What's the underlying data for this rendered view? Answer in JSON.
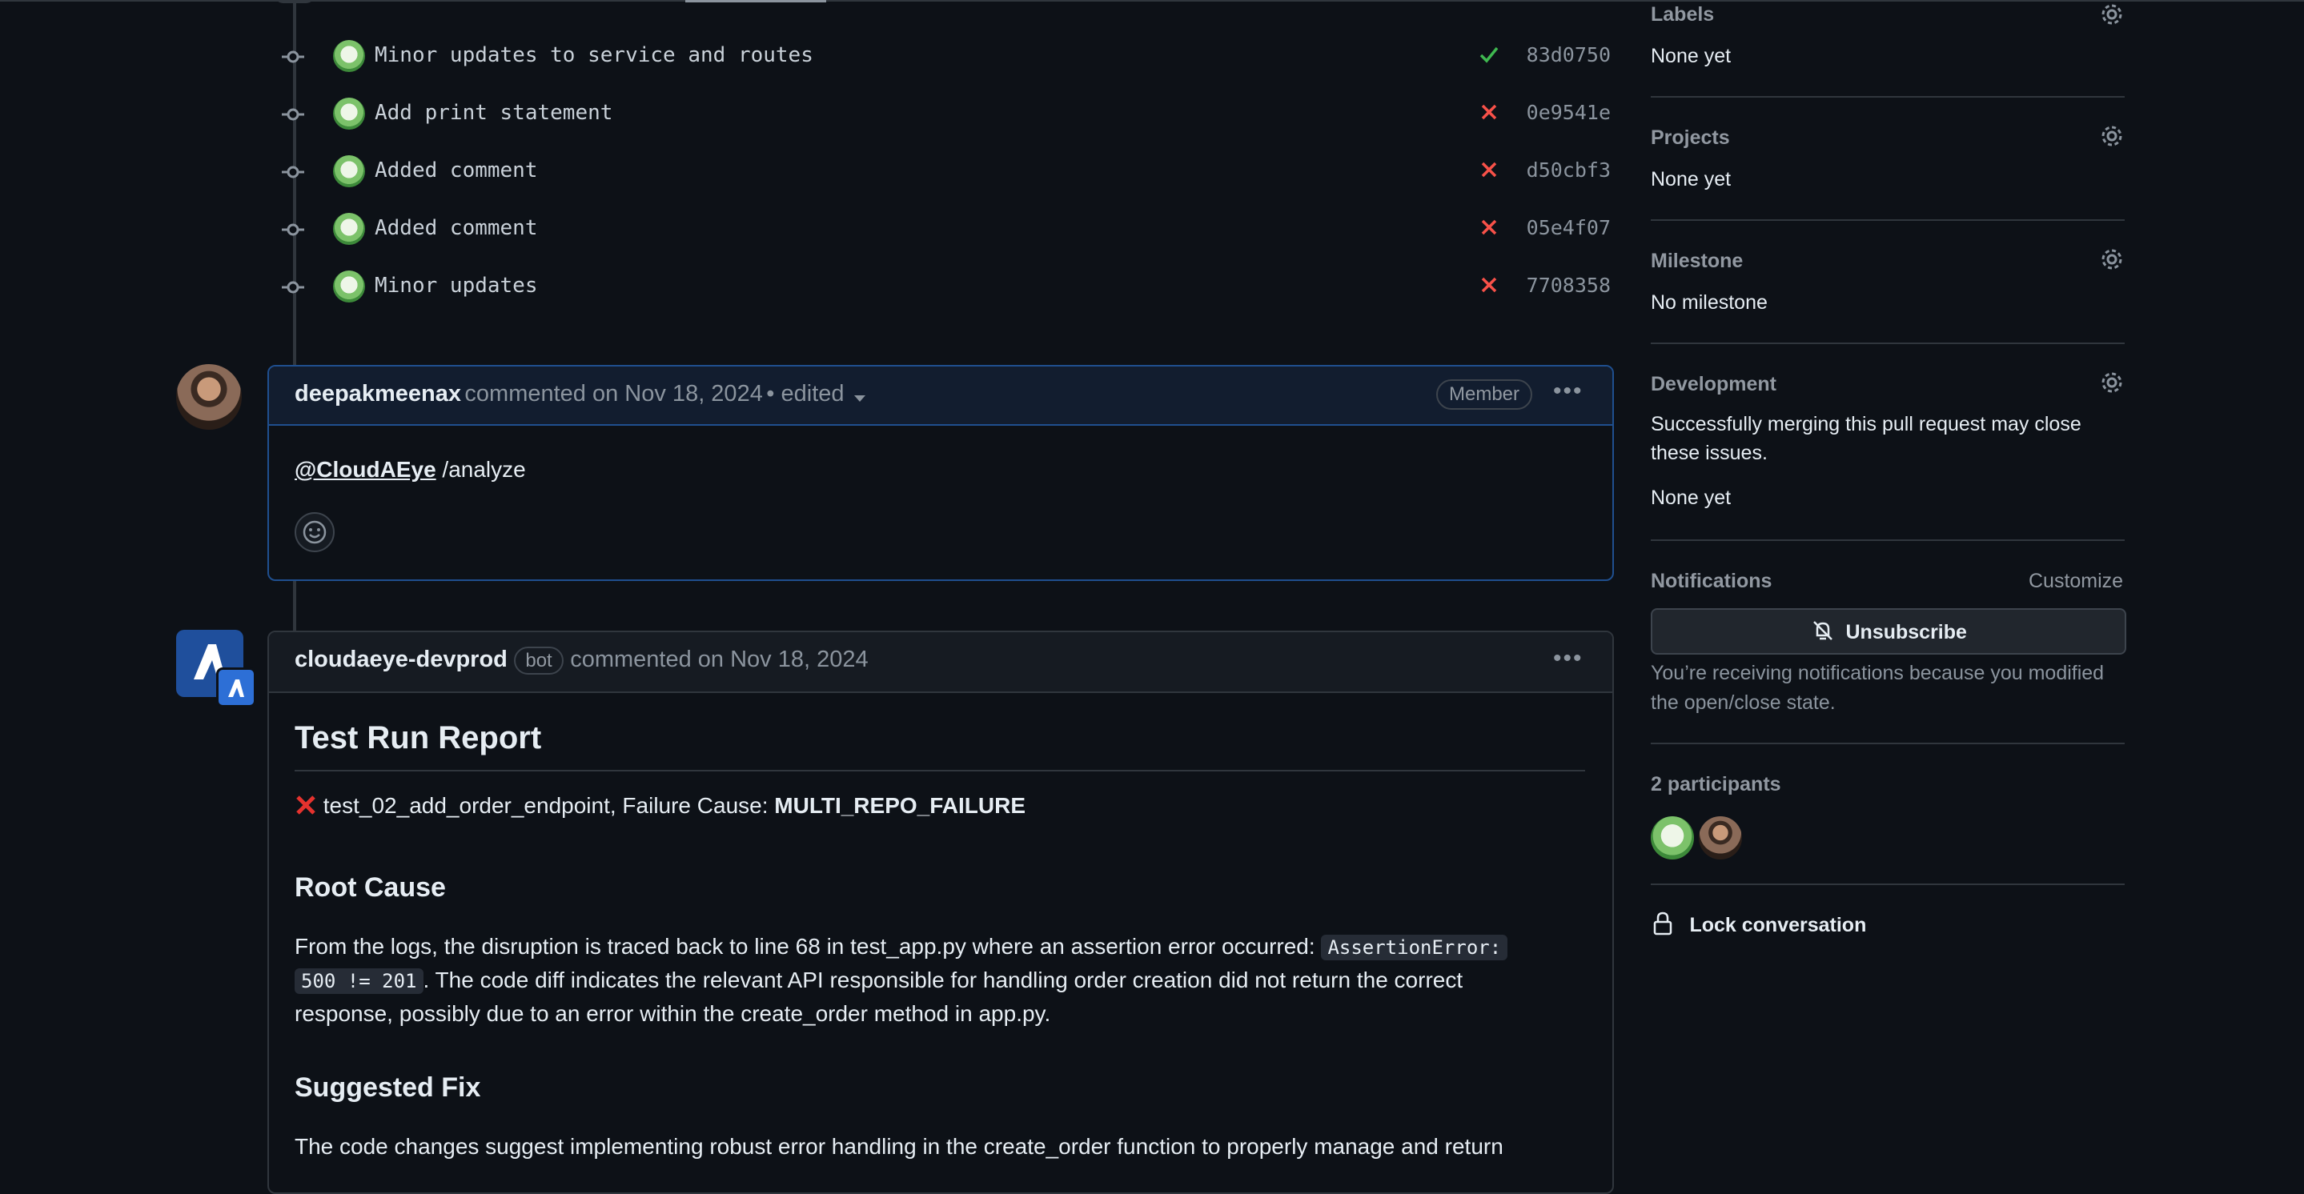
{
  "commits": [
    {
      "message": "Minor updates to service and routes",
      "status": "success",
      "sha": "83d0750"
    },
    {
      "message": "Add print statement",
      "status": "failure",
      "sha": "0e9541e"
    },
    {
      "message": "Added comment",
      "status": "failure",
      "sha": "d50cbf3"
    },
    {
      "message": "Added comment",
      "status": "failure",
      "sha": "05e4f07"
    },
    {
      "message": "Minor updates",
      "status": "failure",
      "sha": "7708358"
    }
  ],
  "comment1": {
    "author": "deepakmeenax",
    "meta": "commented on Nov 18, 2024",
    "edited": "• edited",
    "badge": "Member",
    "mention": "@CloudAEye",
    "text": " /analyze"
  },
  "comment2": {
    "author": "cloudaeye-devprod",
    "badge": "bot",
    "meta": "commented on Nov 18, 2024",
    "title": "Test Run Report",
    "failure_test": "test_02_add_order_endpoint, Failure Cause: ",
    "failure_cause": "MULTI_REPO_FAILURE",
    "root_cause_heading": "Root Cause",
    "root_cause_p1": "From the logs, the disruption is traced back to line 68 in test_app.py where an assertion error occurred: ",
    "root_cause_code1": "AssertionError:",
    "root_cause_code2": "500 != 201",
    "root_cause_p2": ". The code diff indicates the relevant API responsible for handling order creation did not return the correct",
    "root_cause_p3": "response, possibly due to an error within the create_order method in app.py.",
    "suggested_fix_heading": "Suggested Fix",
    "suggested_fix_p1": "The code changes suggest implementing robust error handling in the create_order function to properly manage and return"
  },
  "sidebar": {
    "labels": {
      "title": "Labels",
      "value": "None yet"
    },
    "projects": {
      "title": "Projects",
      "value": "None yet"
    },
    "milestone": {
      "title": "Milestone",
      "value": "No milestone"
    },
    "development": {
      "title": "Development",
      "desc1": "Successfully merging this pull request may close",
      "desc2": "these issues.",
      "value": "None yet"
    },
    "notifications": {
      "title": "Notifications",
      "customize": "Customize",
      "button": "Unsubscribe",
      "note1": "You’re receiving notifications because you modified",
      "note2": "the open/close state."
    },
    "participants": {
      "title": "2 participants"
    },
    "lock": {
      "label": "Lock conversation"
    }
  },
  "colors": {
    "accent": "#1f6feb",
    "success": "#3fb950",
    "danger": "#f85149"
  }
}
